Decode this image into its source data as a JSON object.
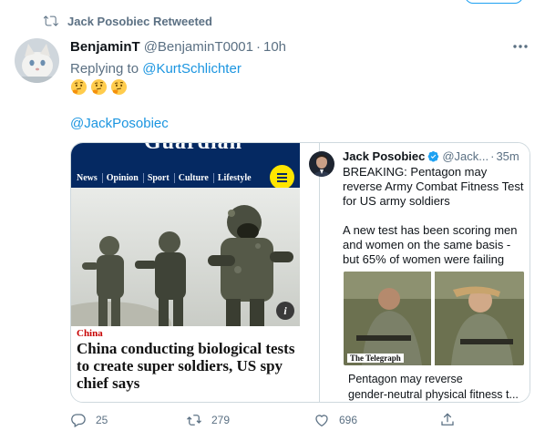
{
  "top_strip": {
    "tweets_count_label": ""
  },
  "retweet_context": {
    "text": "Jack Posobiec Retweeted"
  },
  "tweet": {
    "name": "BenjaminT",
    "handle": "@BenjaminT0001",
    "separator": "·",
    "time": "10h",
    "replying_prefix": "Replying to ",
    "replying_to": "@KurtSchlichter",
    "emojis": [
      "thinking-face",
      "thinking-face",
      "thinking-face"
    ],
    "mention": "@JackPosobiec"
  },
  "card": {
    "left": {
      "site_logo": "Guardian",
      "nav": [
        "News",
        "Opinion",
        "Sport",
        "Culture",
        "Lifestyle"
      ],
      "info_badge": "i",
      "kicker": "China",
      "headline": "China conducting biological tests to create super soldiers, US spy chief says"
    },
    "right": {
      "name": "Jack Posobiec",
      "handle": "@Jack...",
      "separator": "·",
      "time": "35m",
      "text_1": "BREAKING: Pentagon may reverse Army Combat Fitness Test for US army soldiers",
      "text_2": "A new test has been scoring men and women on the same basis - but 65% of women were failing",
      "image_source": "The Telegraph",
      "caption_1": "Pentagon may reverse",
      "caption_2": "gender-neutral physical fitness t..."
    }
  },
  "actions": {
    "reply_count": "25",
    "retweet_count": "279",
    "like_count": "696"
  },
  "colors": {
    "accent": "#1b95e0",
    "muted": "#5b7083",
    "guardian_navy": "#052962",
    "guardian_yellow": "#ffe500",
    "verified": "#1da1f2"
  }
}
